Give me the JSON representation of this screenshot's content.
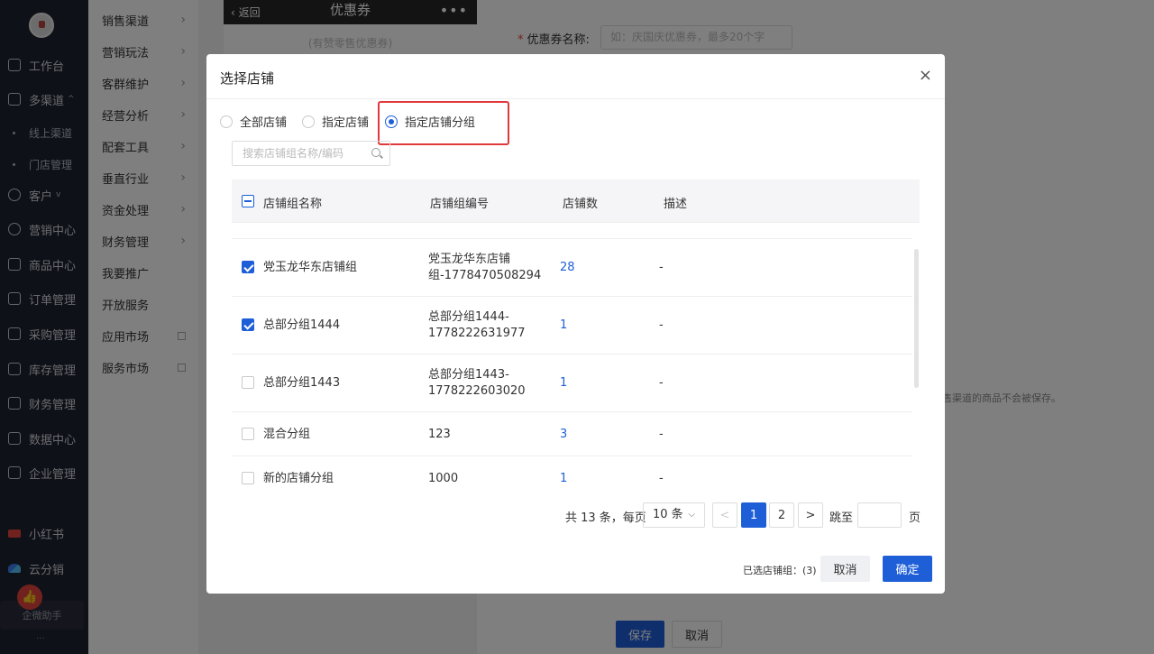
{
  "sidebar": {
    "items": [
      {
        "label": "工作台",
        "icon": "workbench-icon"
      },
      {
        "label": "多渠道",
        "icon": "channel-icon",
        "caret": "^"
      },
      {
        "label": "线上渠道",
        "sub": true
      },
      {
        "label": "门店管理",
        "sub": true
      },
      {
        "label": "客户",
        "icon": "customer-icon",
        "caret": "v"
      },
      {
        "label": "营销中心",
        "icon": "marketing-icon"
      },
      {
        "label": "商品中心",
        "icon": "goods-icon"
      },
      {
        "label": "订单管理",
        "icon": "order-icon"
      },
      {
        "label": "采购管理",
        "icon": "purchase-icon"
      },
      {
        "label": "库存管理",
        "icon": "stock-icon"
      },
      {
        "label": "财务管理",
        "icon": "finance-icon"
      },
      {
        "label": "数据中心",
        "icon": "data-icon"
      },
      {
        "label": "企业管理",
        "icon": "enterprise-icon"
      }
    ],
    "apps": [
      {
        "label": "小红书",
        "icon": "xiaohongshu-icon"
      },
      {
        "label": "云分销",
        "icon": "yunfenxiao-icon"
      }
    ],
    "helper": "企微助手",
    "more": "..."
  },
  "submenu": {
    "items": [
      "销售渠道",
      "营销玩法",
      "客群维护",
      "经营分析",
      "配套工具",
      "垂直行业",
      "资金处理",
      "财务管理",
      "我要推广",
      "开放服务",
      "应用市场",
      "服务市场"
    ]
  },
  "background": {
    "phone_back": "返回",
    "phone_title": "优惠券",
    "phone_dots": "•••",
    "phone_placeholder": "(有赞零售优惠券)",
    "form_label": "优惠券名称:",
    "form_required": "*",
    "form_placeholder": "如：庆国庆优惠券，最多20个字",
    "note": "售渠道的商品不会被保存。",
    "save": "保存",
    "cancel": "取消"
  },
  "modal": {
    "title": "选择店铺",
    "close": "×",
    "radios": [
      "全部店铺",
      "指定店铺",
      "指定店铺分组"
    ],
    "selected_radio": 2,
    "search_placeholder": "搜索店铺组名称/编码",
    "columns": [
      "店铺组名称",
      "店铺组编号",
      "店铺数",
      "描述"
    ],
    "rows": [
      {
        "name": "党玉龙华东店铺组",
        "code": "党玉龙华东店铺组-1778470508294",
        "code_l1": "党玉龙华东店铺",
        "code_l2": "组-1778470508294",
        "count": "28",
        "desc": "-",
        "checked": true
      },
      {
        "name": "总部分组1444",
        "code_l1": "总部分组1444-",
        "code_l2": "1778222631977",
        "count": "1",
        "desc": "-",
        "checked": true
      },
      {
        "name": "总部分组1443",
        "code_l1": "总部分组1443-",
        "code_l2": "1778222603020",
        "count": "1",
        "desc": "-",
        "checked": false
      },
      {
        "name": "混合分组",
        "code_l1": "123",
        "code_l2": "",
        "count": "3",
        "desc": "-",
        "checked": false
      },
      {
        "name": "新的店铺分组",
        "code_l1": "1000",
        "code_l2": "",
        "count": "1",
        "desc": "-",
        "checked": false
      }
    ],
    "pager": {
      "total": "共 13 条，每页",
      "page_size": "10 条",
      "prev": "<",
      "pages": [
        "1",
        "2"
      ],
      "current": "1",
      "next": ">",
      "jump_label": "跳至",
      "jump_suffix": "页"
    },
    "selected_count": "已选店铺组：(3)",
    "cancel": "取消",
    "confirm": "确定"
  },
  "colors": {
    "primary": "#1e5fd8",
    "highlight": "#e0393c",
    "sidebar_bg": "#1f2230"
  }
}
